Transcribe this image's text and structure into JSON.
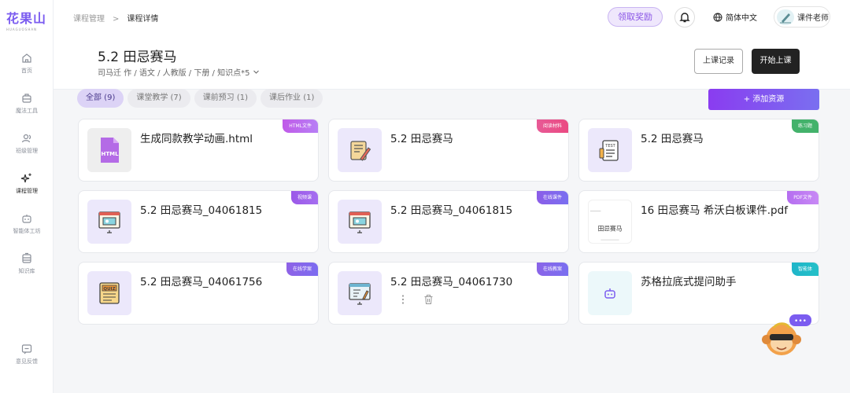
{
  "sidebar": {
    "logo": "花果山",
    "logo_sub": "HUAGUOSHAN",
    "items": [
      {
        "label": "首页"
      },
      {
        "label": "魔法工具"
      },
      {
        "label": "班级管理"
      },
      {
        "label": "课程管理"
      },
      {
        "label": "智能体工坊"
      },
      {
        "label": "知识库"
      }
    ],
    "feedback": "意见反馈"
  },
  "topbar": {
    "breadcrumb": [
      "课程管理",
      "课程详情"
    ],
    "separator": ">",
    "reward": "领取奖励",
    "language": "简体中文",
    "user": "课件老师"
  },
  "header": {
    "title": "5.2 田忌赛马",
    "meta": "司马迁 作 / 语文 / 人教版 / 下册 / 知识点*5",
    "record_btn": "上课记录",
    "start_btn": "开始上课"
  },
  "filters": {
    "tabs": [
      {
        "label": "全部 (9)"
      },
      {
        "label": "课堂教学 (7)"
      },
      {
        "label": "课前预习 (1)"
      },
      {
        "label": "课后作业 (1)"
      }
    ],
    "add": "+ 添加资源"
  },
  "cards": [
    {
      "title": "生成同款教学动画.html",
      "tag": "HTML文件",
      "tag_color": "#c05ae8",
      "icon": "html-file-icon",
      "thumb_text": "HTML"
    },
    {
      "title": "5.2 田忌赛马",
      "tag": "阅读材料",
      "tag_color": "#e85a96",
      "icon": "notepad-pen-icon"
    },
    {
      "title": "5.2 田忌赛马",
      "tag": "练习题",
      "tag_color": "#43b26b",
      "icon": "test-paper-icon",
      "thumb_text": "TEST"
    },
    {
      "title": "5.2 田忌赛马_04061815",
      "tag": "视频课",
      "tag_color": "#9b59e8",
      "icon": "presentation-icon"
    },
    {
      "title": "5.2 田忌赛马_04061815",
      "tag": "在线课件",
      "tag_color": "#8b5de8",
      "icon": "presentation-icon"
    },
    {
      "title": "16 田忌赛马 希沃白板课件.pdf",
      "tag": "PDF文件",
      "tag_color": "#b56ef0",
      "icon": "pdf-preview-icon",
      "thumb_text": "田忌赛马"
    },
    {
      "title": "5.2 田忌赛马_04061756",
      "tag": "在线学案",
      "tag_color": "#8e62e6",
      "icon": "quiz-icon",
      "thumb_text": "QUIZ"
    },
    {
      "title": "5.2 田忌赛马_04061730",
      "tag": "在线教案",
      "tag_color": "#8a64e8",
      "icon": "whiteboard-icon"
    },
    {
      "title": "苏格拉底式提问助手",
      "tag": "智能体",
      "tag_color": "#1fb5c9",
      "icon": "robot-icon"
    }
  ],
  "mascot": {
    "bubble": "•••"
  }
}
